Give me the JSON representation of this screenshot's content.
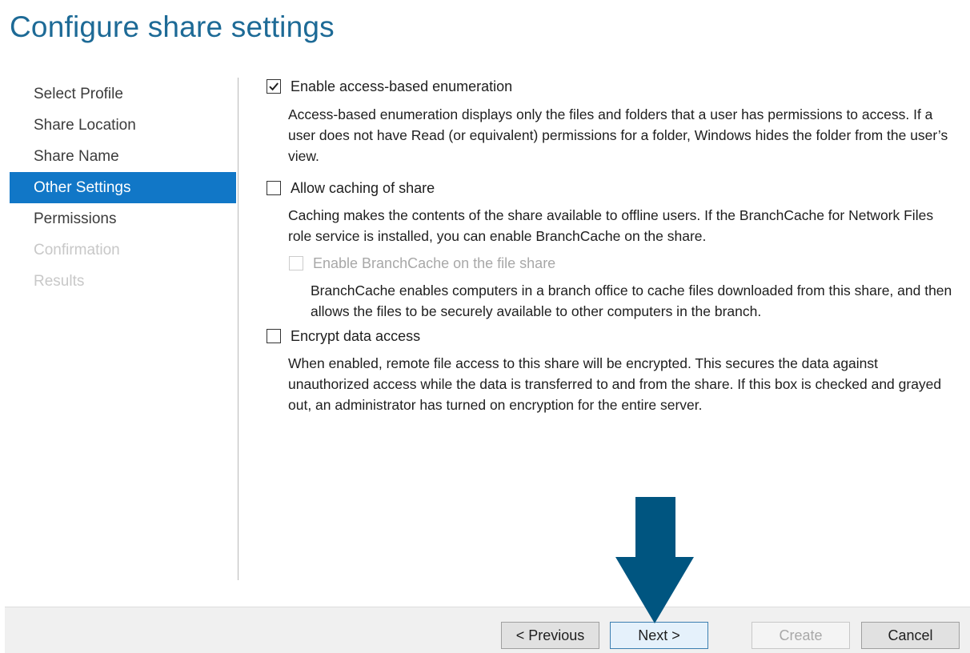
{
  "page": {
    "title": "Configure share settings"
  },
  "nav": {
    "items": [
      {
        "label": "Select Profile",
        "state": "normal"
      },
      {
        "label": "Share Location",
        "state": "normal"
      },
      {
        "label": "Share Name",
        "state": "normal"
      },
      {
        "label": "Other Settings",
        "state": "active"
      },
      {
        "label": "Permissions",
        "state": "normal"
      },
      {
        "label": "Confirmation",
        "state": "disabled"
      },
      {
        "label": "Results",
        "state": "disabled"
      }
    ]
  },
  "options": {
    "abe": {
      "label": "Enable access-based enumeration",
      "checked": true,
      "description": "Access-based enumeration displays only the files and folders that a user has permissions to access. If a user does not have Read (or equivalent) permissions for a folder, Windows hides the folder from the user’s view."
    },
    "caching": {
      "label": "Allow caching of share",
      "checked": false,
      "description": "Caching makes the contents of the share available to offline users. If the BranchCache for Network Files role service is installed, you can enable BranchCache on the share."
    },
    "branchcache": {
      "label": "Enable BranchCache on the file share",
      "checked": false,
      "enabled": false,
      "description": "BranchCache enables computers in a branch office to cache files downloaded from this share, and then allows the files to be securely available to other computers in the branch."
    },
    "encrypt": {
      "label": "Encrypt data access",
      "checked": false,
      "description": "When enabled, remote file access to this share will be encrypted. This secures the data against unauthorized access while the data is transferred to and from the share. If this box is checked and grayed out, an administrator has turned on encryption for the entire server."
    }
  },
  "footer": {
    "previous_label": "< Previous",
    "next_label": "Next >",
    "create_label": "Create",
    "cancel_label": "Cancel"
  },
  "colors": {
    "title": "#1d6a96",
    "nav_active_bg": "#1177c7",
    "annotation_arrow": "#005580"
  },
  "icons": {
    "checkmark": "check-icon",
    "annotation": "down-arrow-icon"
  }
}
